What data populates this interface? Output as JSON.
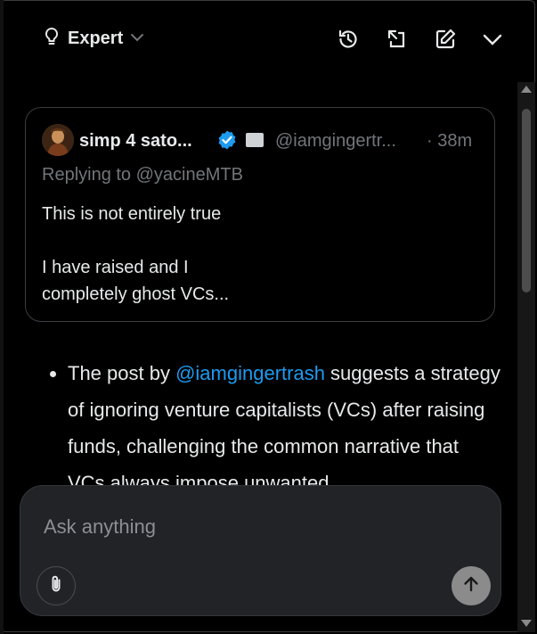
{
  "header": {
    "mode_label": "Expert",
    "icons": [
      "lightbulb-icon",
      "chevron-down-icon",
      "history-icon",
      "expand-icon",
      "compose-icon",
      "collapse-chevron-icon"
    ]
  },
  "quoted_post": {
    "author": "simp 4 sato...",
    "handle": "@iamgingertr...",
    "time": "· 38m",
    "replying_to": "Replying to @yacineMTB",
    "text_line1": "This is not entirely true",
    "text_line2": "I have raised and I",
    "text_line3": "completely ghost VCs..."
  },
  "answer": {
    "prefix": "The post by ",
    "mention": "@iamgingertrash",
    "suffix": " suggests a strategy of ignoring venture capitalists (VCs) after raising funds, challenging the common narrative that VCs always impose unwanted"
  },
  "composer": {
    "placeholder": "Ask anything"
  },
  "colors": {
    "background": "#000000",
    "accent": "#1d9bf0",
    "muted": "#71767b",
    "composer_bg": "#212327"
  }
}
